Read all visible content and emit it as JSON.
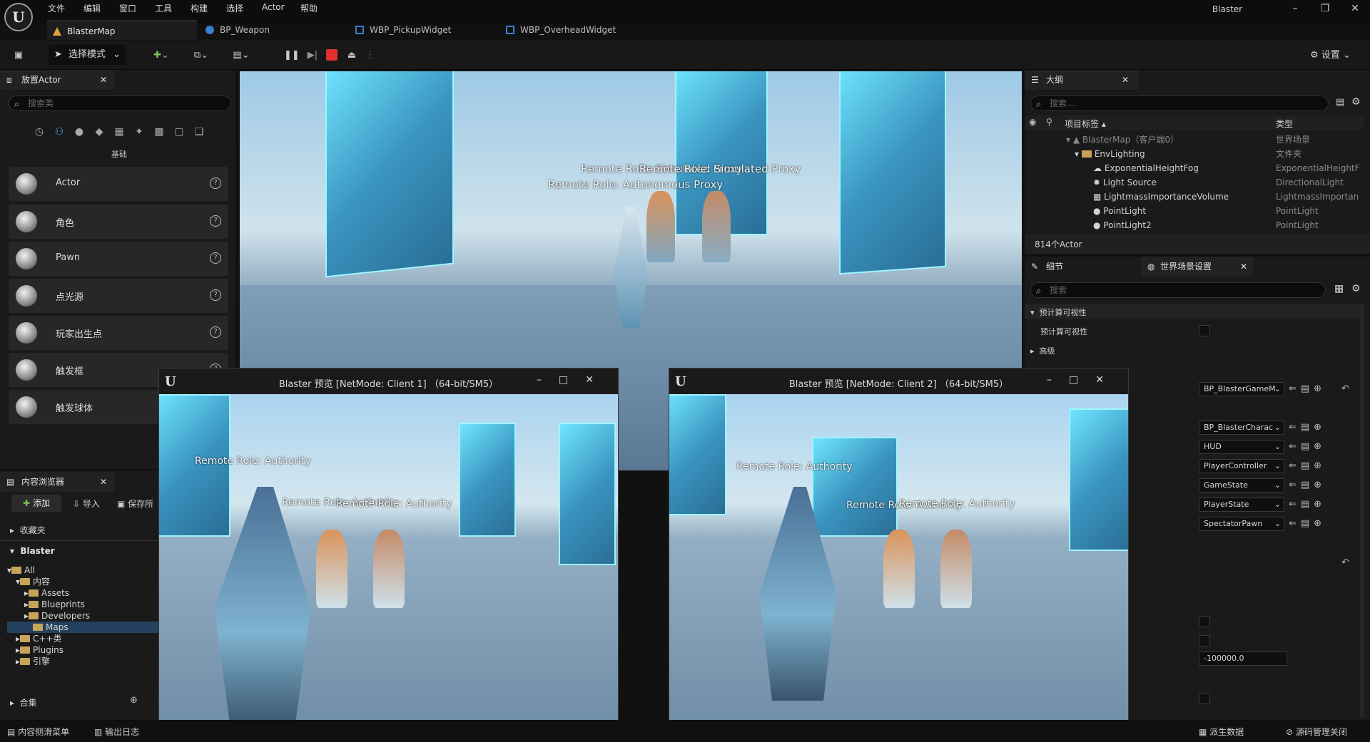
{
  "menubar": {
    "items": [
      "文件",
      "编辑",
      "窗口",
      "工具",
      "构建",
      "选择",
      "Actor",
      "帮助"
    ],
    "app_title": "Blaster"
  },
  "tabs": [
    "BlasterMap",
    "BP_Weapon",
    "WBP_PickupWidget",
    "WBP_OverheadWidget"
  ],
  "toolbar": {
    "mode_label": "选择模式",
    "settings_label": "设置"
  },
  "place_actors": {
    "tab_label": "放置Actor",
    "search_placeholder": "搜索类",
    "category_label": "基础",
    "items": [
      "Actor",
      "角色",
      "Pawn",
      "点光源",
      "玩家出生点",
      "触发框",
      "触发球体"
    ]
  },
  "content_browser": {
    "tab_label": "内容浏览器",
    "add_label": "添加",
    "import_label": "导入",
    "save_label": "保存所",
    "favorites_label": "收藏夹",
    "project_label": "Blaster",
    "tree": [
      "All",
      "内容",
      "Assets",
      "Blueprints",
      "Developers",
      "Maps",
      "C++类",
      "Plugins",
      "引擎"
    ],
    "collections_label": "合集"
  },
  "viewport": {
    "labels": [
      "Remote Role: Simulated Proxy",
      "Remote Role: Simulated Proxy",
      "Remote Role: Autonomous Proxy"
    ]
  },
  "outliner": {
    "tab_label": "大纲",
    "search_placeholder": "搜索...",
    "col_label": "项目标签",
    "col_type": "类型",
    "rows": [
      {
        "label": "BlasterMap（客户端0）",
        "type": "世界场景"
      },
      {
        "label": "EnvLighting",
        "type": "文件夹"
      },
      {
        "label": "ExponentialHeightFog",
        "type": "ExponentialHeightF"
      },
      {
        "label": "Light Source",
        "type": "DirectionalLight"
      },
      {
        "label": "LightmassImportanceVolume",
        "type": "LightmassImportan"
      },
      {
        "label": "PointLight",
        "type": "PointLight"
      },
      {
        "label": "PointLight2",
        "type": "PointLight"
      }
    ],
    "actor_count": "814个Actor"
  },
  "details": {
    "tab_details": "细节",
    "tab_world": "世界场景设置",
    "search_placeholder": "搜索",
    "section_precomputed": "预计算可视性",
    "prop_precomputed": "预计算可视性",
    "section_advanced": "高级",
    "dropdowns": [
      "BP_BlasterGameM",
      "BP_BlasterCharac",
      "HUD",
      "PlayerController",
      "GameState",
      "PlayerState",
      "SpectatorPawn"
    ],
    "kill_z": "-100000.0"
  },
  "pie_client1": {
    "title": "Blaster 预览 [NetMode: Client 1]  （64-bit/SM5）",
    "labels": [
      "Remote Role: Authority",
      "Remote Role: Authority",
      "Remote Role: Authority"
    ]
  },
  "pie_client2": {
    "title": "Blaster 预览 [NetMode: Client 2]  （64-bit/SM5）",
    "labels": [
      "Remote Role: Authority",
      "Remote Role: Authority",
      "Remote Role: Authority"
    ]
  },
  "statusbar": {
    "drawer": "内容侧滑菜单",
    "output_log": "输出日志",
    "derived_data": "派生数据",
    "source_control": "源码管理关闭"
  },
  "colors": {
    "accent_play_stop": "#e03030",
    "crystal": "#4fd8ff",
    "panel_bg": "#1a1a1a"
  }
}
